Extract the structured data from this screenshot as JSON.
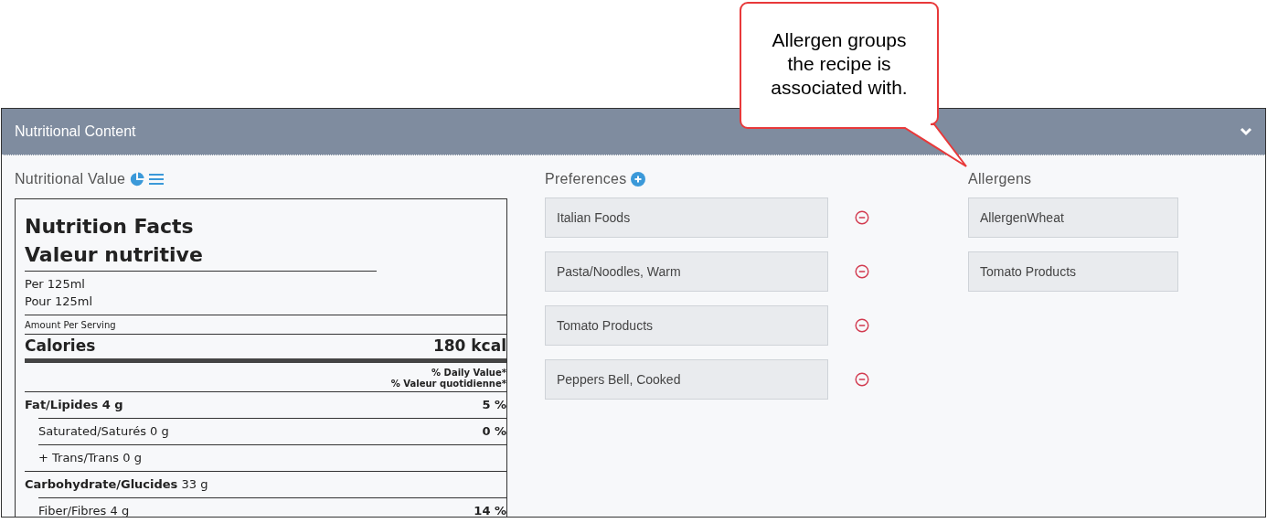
{
  "callout": {
    "text": "Allergen groups the recipe is associated with."
  },
  "panel": {
    "title": "Nutritional Content",
    "expanded": true
  },
  "nutritional_value": {
    "heading": "Nutritional Value",
    "label": {
      "title_en": "Nutrition Facts",
      "title_fr": "Valeur nutritive",
      "serving_en": "Per 125ml",
      "serving_fr": "Pour 125ml",
      "amount_caption": "Amount Per Serving",
      "calories_label": "Calories",
      "calories_value": "180 kcal",
      "dv_en": "% Daily Value*",
      "dv_fr": "% Valeur quotidienne*",
      "nutrients": [
        {
          "label": "Fat/Lipides 4 g",
          "bold": true,
          "dv": "5 %",
          "children": [
            {
              "label": "Saturated/Saturés 0 g",
              "bold": false,
              "dv": "0 %"
            },
            {
              "label": "+ Trans/Trans 0 g",
              "bold": false
            }
          ]
        },
        {
          "label": "**Carbohydrate/Glucides** 33 g",
          "bold": false,
          "children": [
            {
              "label": "Fiber/Fibres 4 g",
              "bold": false,
              "dv": "14 %"
            }
          ]
        }
      ]
    }
  },
  "preferences": {
    "heading": "Preferences",
    "items": [
      "Italian Foods",
      "Pasta/Noodles, Warm",
      "Tomato Products",
      "Peppers Bell, Cooked"
    ]
  },
  "allergens": {
    "heading": "Allergens",
    "items": [
      "AllergenWheat",
      "Tomato Products"
    ]
  }
}
